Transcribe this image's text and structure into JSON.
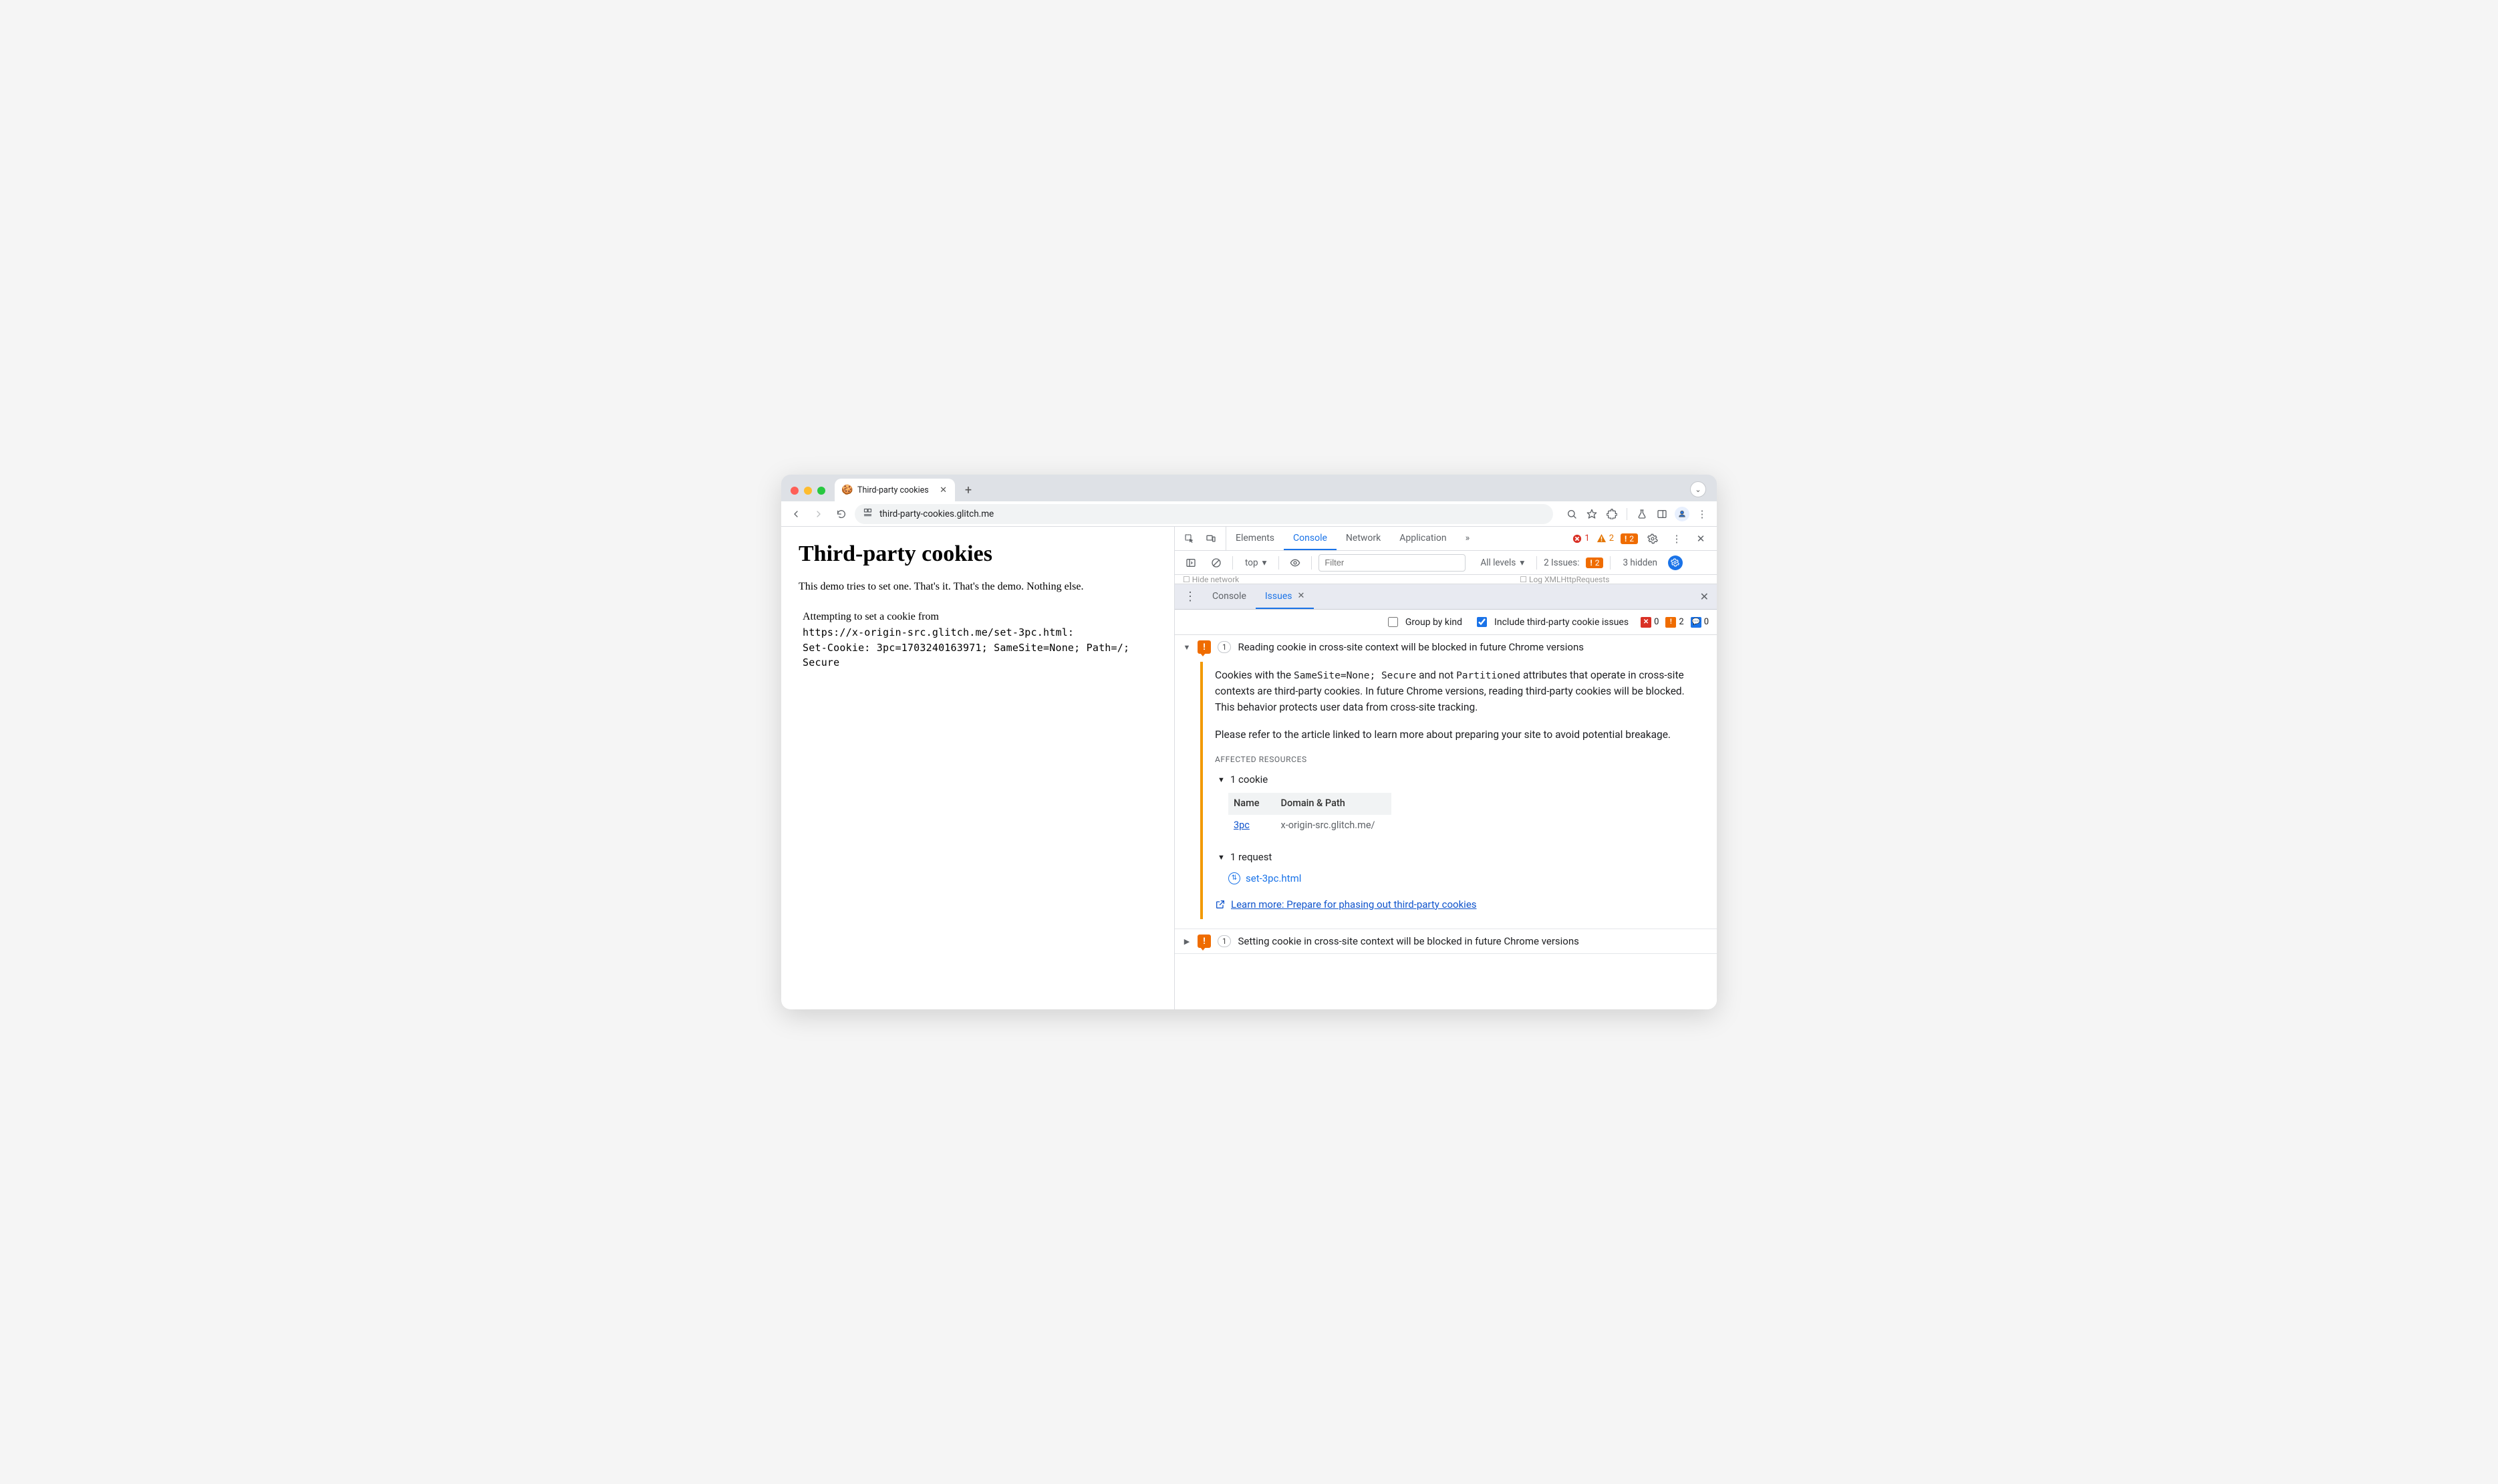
{
  "browser": {
    "tab_title": "Third-party cookies",
    "url": "third-party-cookies.glitch.me"
  },
  "page": {
    "heading": "Third-party cookies",
    "intro": "This demo tries to set one. That's it. That's the demo. Nothing else.",
    "attempt_line1": "Attempting to set a cookie from",
    "attempt_line2": "https://x-origin-src.glitch.me/set-3pc.html:",
    "attempt_line3": "Set-Cookie: 3pc=1703240163971; SameSite=None; Path=/; Secure"
  },
  "devtools": {
    "panels": [
      "Elements",
      "Console",
      "Network",
      "Application"
    ],
    "active_panel": "Console",
    "status": {
      "errors": 1,
      "warnings": 2,
      "issues_chip": 2
    },
    "console_toolbar": {
      "context": "top",
      "filter_placeholder": "Filter",
      "levels": "All levels",
      "issues_label": "2 Issues:",
      "issues_count": 2,
      "hidden_label": "3 hidden"
    },
    "hidden_row": {
      "left": "Hide network",
      "right": "Log XMLHttpRequests"
    },
    "drawer": {
      "tabs": [
        "Console",
        "Issues"
      ],
      "active": "Issues"
    },
    "issues_toolbar": {
      "group_by_kind_label": "Group by kind",
      "group_by_kind_checked": false,
      "include_3p_label": "Include third-party cookie issues",
      "include_3p_checked": true,
      "counts": {
        "err": 0,
        "warn": 2,
        "info": 0
      }
    },
    "issues": [
      {
        "expanded": true,
        "count": 1,
        "title": "Reading cookie in cross-site context will be blocked in future Chrome versions",
        "body_part1": "Cookies with the ",
        "body_code1": "SameSite=None; Secure",
        "body_part2": " and not ",
        "body_code2": "Partitioned",
        "body_part3": " attributes that operate in cross-site contexts are third-party cookies. In future Chrome versions, reading third-party cookies will be blocked. This behavior protects user data from cross-site tracking.",
        "body_para2": "Please refer to the article linked to learn more about preparing your site to avoid potential breakage.",
        "affected_heading": "AFFECTED RESOURCES",
        "cookie_count_label": "1 cookie",
        "cookie_table": {
          "headers": [
            "Name",
            "Domain & Path"
          ],
          "rows": [
            {
              "name": "3pc",
              "domain": "x-origin-src.glitch.me/"
            }
          ]
        },
        "request_count_label": "1 request",
        "request_name": "set-3pc.html",
        "learn_more": "Learn more: Prepare for phasing out third-party cookies"
      },
      {
        "expanded": false,
        "count": 1,
        "title": "Setting cookie in cross-site context will be blocked in future Chrome versions"
      }
    ]
  }
}
